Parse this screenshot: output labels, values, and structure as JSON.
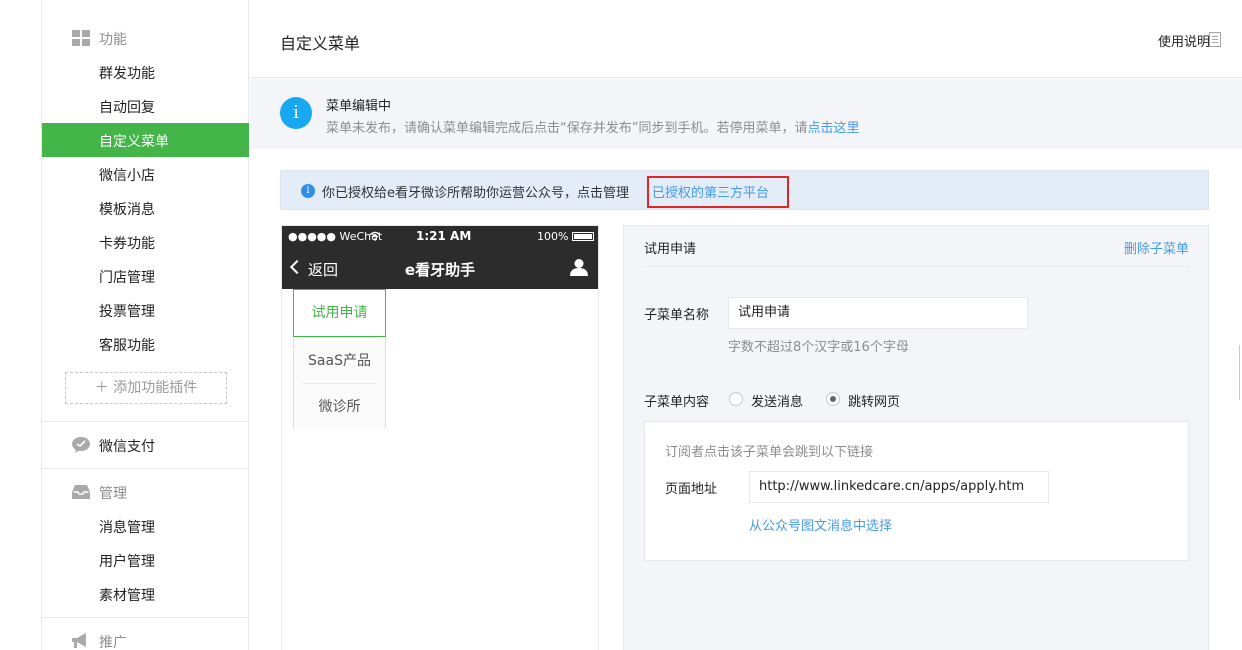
{
  "sidebar": {
    "section_function": "功能",
    "function_items": [
      "群发功能",
      "自动回复",
      "自定义菜单",
      "微信小店",
      "模板消息",
      "卡券功能",
      "门店管理",
      "投票管理",
      "客服功能"
    ],
    "active_item": "自定义菜单",
    "add_plugin": "添加功能插件",
    "section_pay": "微信支付",
    "section_manage": "管理",
    "manage_items": [
      "消息管理",
      "用户管理",
      "素材管理"
    ],
    "section_promote": "推广"
  },
  "header": {
    "title": "自定义菜单",
    "help": "使用说明"
  },
  "notice": {
    "title": "菜单编辑中",
    "desc": "菜单未发布，请确认菜单编辑完成后点击“保存并发布”同步到手机。若停用菜单，请",
    "link": "点击这里"
  },
  "auth": {
    "text": "你已授权给e看牙微诊所帮助你运营公众号，点击管理",
    "link": "已授权的第三方平台"
  },
  "phone": {
    "carrier": "●●●●● WeChat",
    "time": "1:21 AM",
    "battery": "100%",
    "back": "返回",
    "title": "e看牙助手",
    "menu_items": [
      "试用申请",
      "SaaS产品",
      "微诊所"
    ]
  },
  "editor": {
    "title": "试用申请",
    "delete": "删除子菜单",
    "name_label": "子菜单名称",
    "name_value": "试用申请",
    "name_hint": "字数不超过8个汉字或16个字母",
    "content_label": "子菜单内容",
    "option_send": "发送消息",
    "option_jump": "跳转网页",
    "url_desc": "订阅者点击该子菜单会跳到以下链接",
    "url_label": "页面地址",
    "url_value": "http://www.linkedcare.cn/apps/apply.htm",
    "url_select": "从公众号图文消息中选择"
  },
  "colors": {
    "accent": "#44b549",
    "link": "#459ae9",
    "highlight": "#e02525"
  }
}
